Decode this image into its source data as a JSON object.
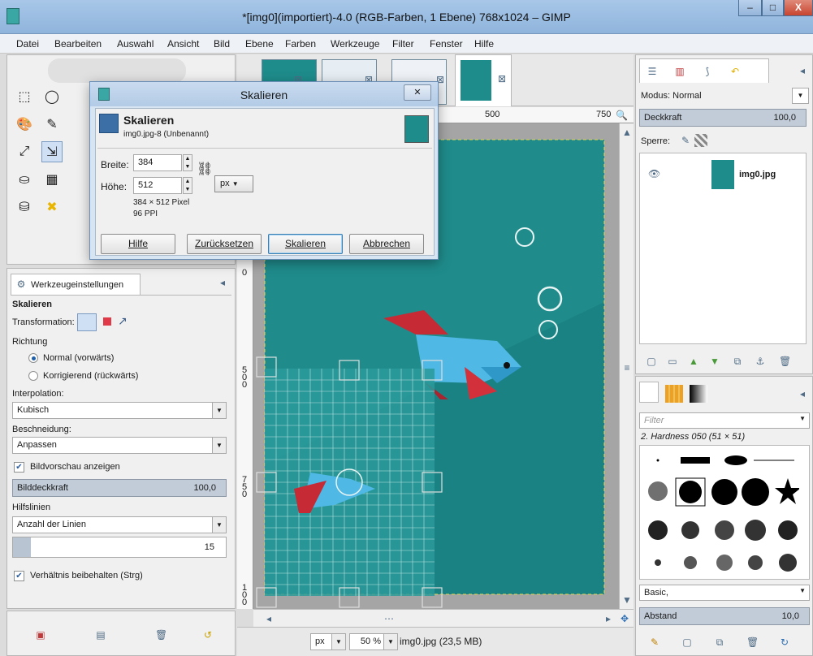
{
  "window": {
    "title": "*[img0](importiert)-4.0 (RGB-Farben, 1 Ebene) 768x1024 – GIMP",
    "minimize": "–",
    "maximize": "□",
    "close": "X"
  },
  "menu": [
    "Datei",
    "Bearbeiten",
    "Auswahl",
    "Ansicht",
    "Bild",
    "Ebene",
    "Farben",
    "Werkzeuge",
    "Filter",
    "Fenster",
    "Hilfe"
  ],
  "dialog": {
    "title": "Skalieren",
    "close": "✕",
    "heading": "Skalieren",
    "subheading": "img0.jpg-8 (Unbenannt)",
    "width_label": "Breite:",
    "width_value": "384",
    "height_label": "Höhe:",
    "height_value": "512",
    "unit": "px",
    "size_info": "384 × 512 Pixel",
    "ppi_info": "96 PPI",
    "buttons": {
      "help": "Hilfe",
      "reset": "Zurücksetzen",
      "scale": "Skalieren",
      "cancel": "Abbrechen"
    }
  },
  "tool_options": {
    "tab_label": "Werkzeugeinstellungen",
    "tool_name": "Skalieren",
    "transformation_label": "Transformation:",
    "direction_label": "Richtung",
    "direction_normal": "Normal (vorwärts)",
    "direction_corrective": "Korrigierend (rückwärts)",
    "interpolation_label": "Interpolation:",
    "interpolation_value": "Kubisch",
    "clipping_label": "Beschneidung:",
    "clipping_value": "Anpassen",
    "preview_label": "Bildvorschau anzeigen",
    "opacity_label": "Bilddeckkraft",
    "opacity_value": "100,0",
    "guides_label": "Hilfslinien",
    "guides_value": "Anzahl der Linien",
    "lines_value": "15",
    "keep_ratio_label": "Verhältnis beibehalten (Strg)"
  },
  "canvas": {
    "ruler_500": "500",
    "ruler_750": "750",
    "vruler_0": "0",
    "vruler_500": "500",
    "vruler_750": "750",
    "vruler_1000": "100"
  },
  "statusbar": {
    "unit": "px",
    "zoom": "50 %",
    "file_info": "img0.jpg (23,5 MB)"
  },
  "layers": {
    "mode_label": "Modus: Normal",
    "opacity_label": "Deckkraft",
    "opacity_value": "100,0",
    "lock_label": "Sperre:",
    "layer_name": "img0.jpg"
  },
  "brushes": {
    "filter_placeholder": "Filter",
    "brush_name": "2. Hardness 050 (51 × 51)",
    "preset": "Basic,",
    "spacing_label": "Abstand",
    "spacing_value": "10,0"
  },
  "colors": {
    "canvas_teal": "#1f8b8b",
    "fish_blue": "#4fb8e4",
    "fish_red": "#d2303a",
    "titlebar": "#9cbde2"
  }
}
